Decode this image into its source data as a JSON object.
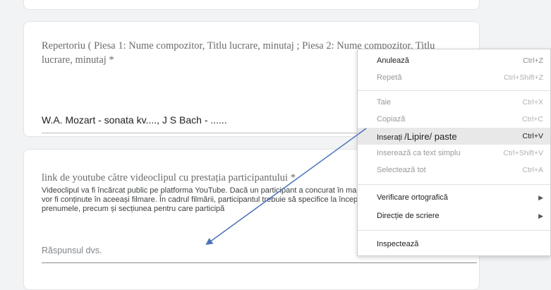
{
  "repertoire": {
    "title": "Repertoriu ( Piesa 1: Nume compozitor, Titlu lucrare, minutaj ; Piesa 2: Nume compozitor, Titlu lucrare, minutaj *",
    "answer": "W.A. Mozart - sonata kv...., J S Bach - ......"
  },
  "youtube": {
    "title": "link de youtube către videoclipul cu prestația participantului *",
    "description": "Videoclipul va fi încărcat public pe platforma YouTube. Dacă un participant a concurat în mai multe secțiuni, toate lucrările vor fi conținute în aceeași filmare. În cadrul filmării, participantul trebuie să specifice la începutul prestației numele și prenumele, precum și secțiunea pentru care participă",
    "placeholder": "Răspunsul dvs."
  },
  "context_menu": {
    "items": [
      {
        "label": "Anulează",
        "shortcut": "Ctrl+Z"
      },
      {
        "label": "Repetă",
        "shortcut": "Ctrl+Shift+Z"
      },
      {
        "label": "Taie",
        "shortcut": "Ctrl+X"
      },
      {
        "label": "Copiază",
        "shortcut": "Ctrl+C"
      },
      {
        "label": "Inserați",
        "annotation": "/Lipire/ paste",
        "shortcut": "Ctrl+V"
      },
      {
        "label": "Inserează ca text simplu",
        "shortcut": "Ctrl+Shift+V"
      },
      {
        "label": "Selectează tot",
        "shortcut": "Ctrl+A"
      },
      {
        "label": "Verificare ortografică"
      },
      {
        "label": "Direcție de scriere"
      },
      {
        "label": "Inspectează"
      }
    ]
  },
  "colors": {
    "annotation_arrow": "#4a72b8",
    "highlight": "#e8e8e8",
    "background": "#f1f3f4"
  }
}
